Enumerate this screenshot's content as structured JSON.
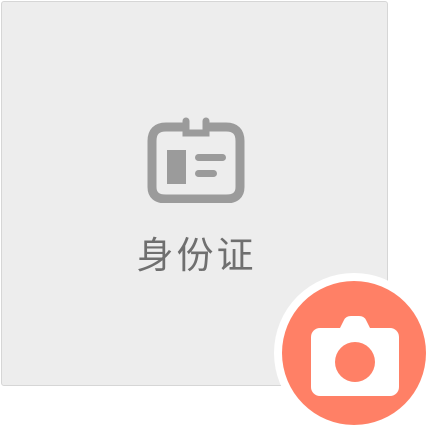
{
  "upload_card": {
    "label": "身份证",
    "icon": "id-card-icon"
  },
  "camera_button": {
    "icon": "camera-icon"
  },
  "colors": {
    "card_background": "#ededed",
    "card_border": "#d6d6d6",
    "icon_gray": "#9b9b9b",
    "label_text": "#6f6f6f",
    "accent": "#ff8066"
  }
}
